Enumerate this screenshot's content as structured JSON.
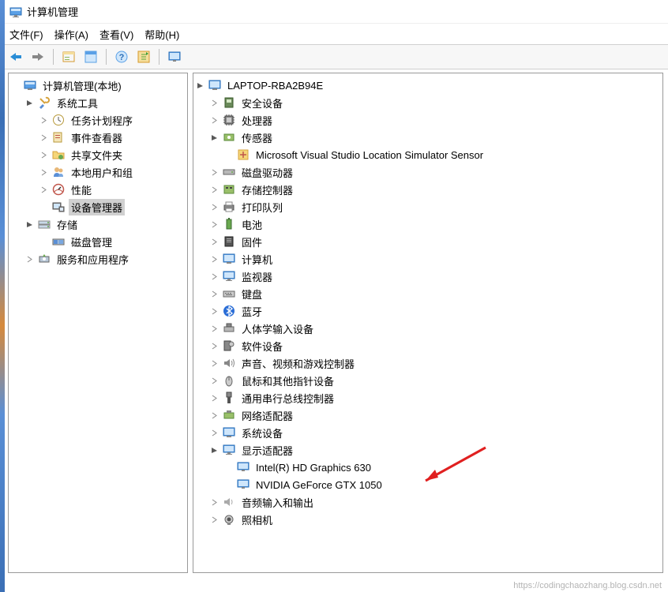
{
  "window": {
    "title": "计算机管理"
  },
  "menu": {
    "file": "文件(F)",
    "action": "操作(A)",
    "view": "查看(V)",
    "help": "帮助(H)"
  },
  "left_tree": {
    "root": "计算机管理(本地)",
    "system_tools": "系统工具",
    "task_scheduler": "任务计划程序",
    "event_viewer": "事件查看器",
    "shared_folders": "共享文件夹",
    "local_users_groups": "本地用户和组",
    "performance": "性能",
    "device_manager": "设备管理器",
    "storage": "存储",
    "disk_management": "磁盘管理",
    "services_apps": "服务和应用程序"
  },
  "right_tree": {
    "computer_name": "LAPTOP-RBA2B94E",
    "security_devices": "安全设备",
    "processors": "处理器",
    "sensors": "传感器",
    "sensor_item": "Microsoft Visual Studio Location Simulator Sensor",
    "disk_drives": "磁盘驱动器",
    "storage_controllers": "存储控制器",
    "print_queues": "打印队列",
    "batteries": "电池",
    "firmware": "固件",
    "computer": "计算机",
    "monitors": "监视器",
    "keyboards": "键盘",
    "bluetooth": "蓝牙",
    "hid": "人体学输入设备",
    "software_devices": "软件设备",
    "sound_video_game": "声音、视频和游戏控制器",
    "mice": "鼠标和其他指针设备",
    "usb_controllers": "通用串行总线控制器",
    "network_adapters": "网络适配器",
    "system_devices": "系统设备",
    "display_adapters": "显示适配器",
    "gpu_intel": "Intel(R) HD Graphics 630",
    "gpu_nvidia": "NVIDIA GeForce GTX 1050",
    "audio_io": "音频输入和输出",
    "cameras": "照相机"
  },
  "watermark": "https://codingchaozhang.blog.csdn.net"
}
